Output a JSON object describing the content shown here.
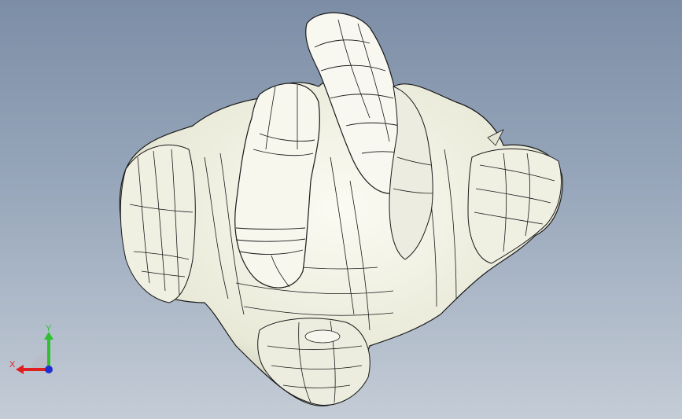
{
  "viewport": {
    "background_top": "#7c8ea6",
    "background_bottom": "#c4ccd6"
  },
  "model": {
    "surface_color": "#f4f4ea",
    "shade_color": "#c9c9b4",
    "edge_color": "#1a1a1a"
  },
  "triad": {
    "x_label": "X",
    "y_label": "Y",
    "x_color": "#e02020",
    "y_color": "#2ec02e",
    "z_color": "#2030d0"
  }
}
